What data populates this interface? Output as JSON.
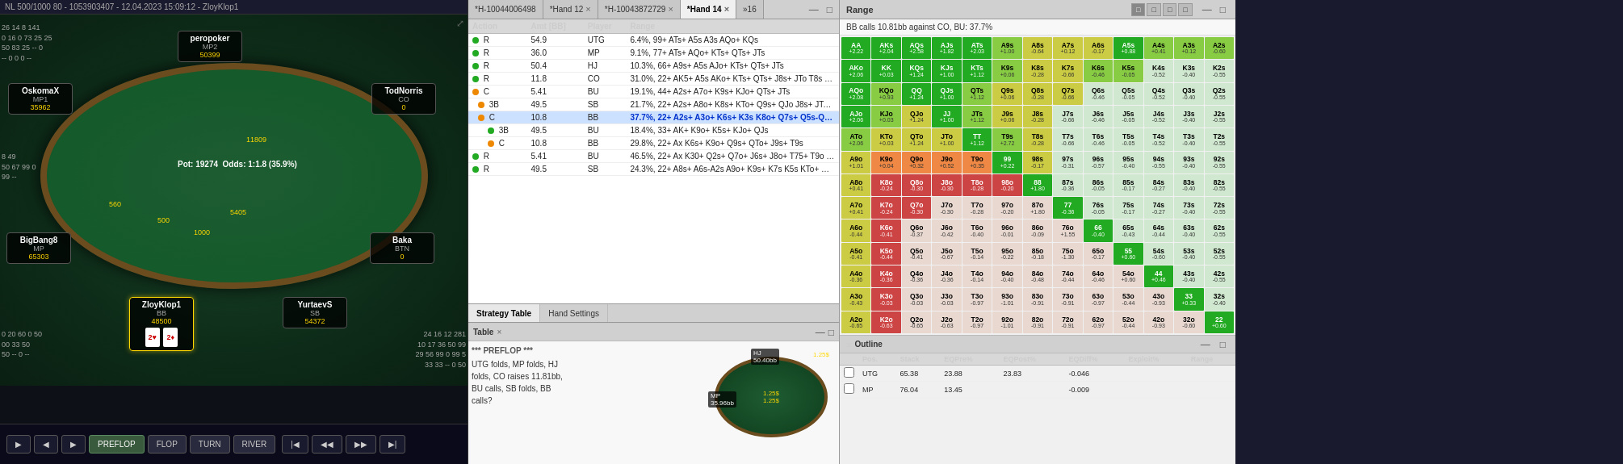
{
  "pokerPanel": {
    "header": "NL 500/1000 80 - 1053903407 - 12.04.2023 15:09:12 - ZloyKlop1",
    "pot": "19274",
    "odds": "1:1.8 (35.9%)",
    "players": [
      {
        "name": "peropoker",
        "position": "MP2",
        "chips": "50399",
        "cards": "",
        "seat": "top-center"
      },
      {
        "name": "OskomaX",
        "position": "MP1",
        "chips": "35962",
        "cards": "",
        "seat": "left-upper"
      },
      {
        "name": "TodNorris",
        "position": "CO",
        "chips": "0",
        "cards": "",
        "seat": "right-upper"
      },
      {
        "name": "Baka",
        "position": "BTN",
        "chips": "0",
        "cards": "",
        "seat": "right-lower"
      },
      {
        "name": "ZloyKlop1",
        "position": "BB",
        "chips": "48500",
        "cards": "2♥ 2♦",
        "seat": "bottom-left"
      },
      {
        "name": "YurtaevS",
        "position": "SB",
        "chips": "54372",
        "cards": "",
        "seat": "bottom-right"
      },
      {
        "name": "BigBang8",
        "position": "MP",
        "chips": "65303",
        "cards": "",
        "seat": "left-lower"
      }
    ],
    "stats": {
      "hand1": "26 14 8 141",
      "hand2": "0 16 0 73 25 25",
      "hand3": "50 83 25 -- 0",
      "hand4": "-- 0 0 0 --",
      "hand5": "8 49",
      "hand6": "50 67 99 0",
      "hand7": "99 --",
      "hand8": "0 20 60 0 50",
      "hand9": "00 33 50",
      "hand10": "50 -- 0 --",
      "hand11": "24 16 12 281",
      "hand12": "10 17 36 50 99",
      "hand13": "29 56 99 0 99 5",
      "hand14": "33 33 -- 0 50"
    },
    "controls": [
      "PREFLOP",
      "FLOP",
      "TURN",
      "RIVER"
    ],
    "chipAmounts": [
      "560",
      "5405",
      "1000",
      "500",
      "11809"
    ]
  },
  "handPanel": {
    "tabs": [
      {
        "id": "tab1",
        "label": "*H-10044006498",
        "closable": false,
        "active": false
      },
      {
        "id": "tab2",
        "label": "*Hand 12",
        "closable": true,
        "active": false
      },
      {
        "id": "tab3",
        "label": "*H-10043872729",
        "closable": true,
        "active": false
      },
      {
        "id": "tab4",
        "label": "*Hand 14",
        "closable": true,
        "active": true
      },
      {
        "id": "tab5",
        "label": "»16",
        "closable": false,
        "active": false
      }
    ],
    "columns": [
      "Action",
      "Amt [BB]",
      "Player",
      "Range"
    ],
    "rows": [
      {
        "type": "action",
        "indicator": "green",
        "action": "R",
        "amount": "54.9",
        "player": "UTG",
        "range": "6.4%, 99+ ATs+ A5s A3s AQo+ KQs",
        "expanded": false,
        "indent": 0
      },
      {
        "type": "action",
        "indicator": "green",
        "action": "R",
        "amount": "36.0",
        "player": "MP",
        "range": "9.1%, 77+ ATs+ AQo+ KTs+ QTs+ JTs",
        "expanded": false,
        "indent": 0
      },
      {
        "type": "action",
        "indicator": "green",
        "action": "R",
        "amount": "50.4",
        "player": "HJ",
        "range": "10.3%, 66+ A9s+ A5s AJo+ KTs+ QTs+ JTs",
        "expanded": false,
        "indent": 0
      },
      {
        "type": "action",
        "indicator": "green",
        "action": "R",
        "amount": "11.8",
        "player": "CO",
        "range": "31.0%, 22+ AK5+ A5s AKo+ KTs+ QTs+ J8s+ JTo T8s 98s",
        "expanded": false,
        "indent": 0
      },
      {
        "type": "action",
        "indicator": "orange",
        "action": "C",
        "amount": "5.41",
        "player": "BU",
        "range": "19.1%, 44+ A2s+ A7o+ K9s+ KJo+ QTs+ JTs",
        "expanded": false,
        "indent": 0
      },
      {
        "type": "action",
        "indicator": "orange",
        "action": "3B",
        "amount": "49.5",
        "player": "SB",
        "range": "21.7%, 22+ A2s+ A8o+ K8s+ KTo+ Q9s+ QJo J8s+ JTo T9s 76s",
        "expanded": false,
        "indent": 1
      },
      {
        "type": "action",
        "indicator": "orange",
        "action": "C",
        "amount": "10.8",
        "player": "BB",
        "range": "37.7%, 22+ A2s+ A3o+ K6s+ K3s K8o+ Q7s+ Q5s-Q4s Q9o+ J7...",
        "expanded": true,
        "highlighted": true,
        "indent": 1
      },
      {
        "type": "action",
        "indicator": "green",
        "action": "3B",
        "amount": "49.5",
        "player": "BU",
        "range": "18.4%, 33+ AK+ K9o+ K5s+ KJo+ QJs",
        "expanded": false,
        "indent": 2
      },
      {
        "type": "action",
        "indicator": "orange",
        "action": "C",
        "amount": "10.8",
        "player": "BB",
        "range": "29.8%, 22+ Ax K6s+ K9o+ Q9s+ QTo+ J9s+ T9s",
        "expanded": false,
        "indent": 2
      },
      {
        "type": "action",
        "indicator": "green",
        "action": "R",
        "amount": "5.41",
        "player": "BU",
        "range": "46.5%, 22+ Ax K30+ Q2s+ Q7o+ J6s+ J8o+ T75+ T9o 97s+",
        "expanded": false,
        "indent": 0
      },
      {
        "type": "action",
        "indicator": "green",
        "action": "R",
        "amount": "49.5",
        "player": "SB",
        "range": "24.3%, 22+ A8s+ A6s-A2s A9o+ K9s+ K7s K5s KTo+ Q8s+ QTo+...",
        "expanded": false,
        "indent": 0
      }
    ],
    "bottomTabs": [
      {
        "label": "Strategy Table",
        "active": true
      },
      {
        "label": "Hand Settings",
        "active": false
      }
    ]
  },
  "tablePanel": {
    "title": "Table",
    "closeBtn": "×",
    "text": "*** PREFLOP ***\nUTG folds, MP folds, HJ folds, CO raises 11.81bb, BU calls, SB folds, BB calls?",
    "miniPlayers": [
      {
        "label": "MP",
        "chips": "35.96bb",
        "pos": "left"
      },
      {
        "label": "HJ",
        "chips": "50.40bb",
        "pos": "top"
      }
    ],
    "potLabels": [
      "1.25$",
      "1.25$",
      "1.25$"
    ]
  },
  "rangePanel": {
    "title": "Range",
    "description": "BB calls 10.81bb against CO, BU: 37.7%",
    "viewButtons": [
      "□",
      "□",
      "□",
      "□"
    ],
    "hands": [
      [
        "AA",
        "AKs",
        "AQs",
        "AJs",
        "ATs",
        "A9s",
        "A8s",
        "A7s",
        "A6s",
        "A5s",
        "A4s",
        "A3s",
        "A2s"
      ],
      [
        "AKo",
        "KK",
        "KQs",
        "KJs",
        "KTs",
        "K9s",
        "K8s",
        "K7s",
        "K6s",
        "K5s",
        "K4s",
        "K3s",
        "K2s"
      ],
      [
        "AQo",
        "KQo",
        "QQ",
        "QJs",
        "QTs",
        "Q9s",
        "Q8s",
        "Q7s",
        "Q6s",
        "Q5s",
        "Q4s",
        "Q3s",
        "Q2s"
      ],
      [
        "AJo",
        "KJo",
        "QJo",
        "JJ",
        "JTs",
        "J9s",
        "J8s",
        "J7s",
        "J6s",
        "J5s",
        "J4s",
        "J3s",
        "J2s"
      ],
      [
        "ATo",
        "KTo",
        "QTo",
        "JTo",
        "TT",
        "T9s",
        "T8s",
        "T7s",
        "T6s",
        "T5s",
        "T4s",
        "T3s",
        "T2s"
      ],
      [
        "A9o",
        "K9o",
        "Q9o",
        "J9o",
        "T9o",
        "99",
        "98s",
        "97s",
        "96s",
        "95s",
        "94s",
        "93s",
        "92s"
      ],
      [
        "A8o",
        "K8o",
        "Q8o",
        "J8o",
        "T8o",
        "98o",
        "88",
        "87s",
        "86s",
        "85s",
        "84s",
        "83s",
        "82s"
      ],
      [
        "A7o",
        "K7o",
        "Q7o",
        "J7o",
        "T7o",
        "97o",
        "87o",
        "77",
        "76s",
        "75s",
        "74s",
        "73s",
        "72s"
      ],
      [
        "A6o",
        "K6o",
        "Q6o",
        "J6o",
        "T6o",
        "96o",
        "86o",
        "76o",
        "66",
        "65s",
        "64s",
        "63s",
        "62s"
      ],
      [
        "A5o",
        "K5o",
        "Q5o",
        "J5o",
        "T5o",
        "95o",
        "85o",
        "75o",
        "65o",
        "55",
        "54s",
        "53s",
        "52s"
      ],
      [
        "A4o",
        "K4o",
        "Q4o",
        "J4o",
        "T4o",
        "94o",
        "84o",
        "74o",
        "64o",
        "54o",
        "44",
        "43s",
        "42s"
      ],
      [
        "A3o",
        "K3o",
        "Q3o",
        "J3o",
        "T3o",
        "93o",
        "83o",
        "73o",
        "63o",
        "53o",
        "43o",
        "33",
        "32s"
      ],
      [
        "A2o",
        "K2o",
        "Q2o",
        "J2o",
        "T2o",
        "92o",
        "82o",
        "72o",
        "62o",
        "52o",
        "42o",
        "32o",
        "22"
      ]
    ],
    "handValues": [
      [
        "+2.22",
        "+2.04",
        "+2.58",
        "+1.82",
        "+2.03",
        "+1.00",
        "-0.64",
        "+0.12",
        "-0.17",
        "+0.88",
        "+0.41",
        "+0.12",
        "-0.60"
      ],
      [
        "+2.06",
        "+0.03",
        "+1.24",
        "+1.00",
        "+1.12",
        "+0.06",
        "-0.28",
        "-0.66",
        "-0.46",
        "-0.05",
        "-0.52",
        "",
        ""
      ],
      [
        "+2.08",
        "+0.93",
        "+1.24",
        "+1.00",
        "+1.12",
        "+0.06",
        "-0.28",
        "-0.66",
        "-0.46",
        "-0.05",
        "-0.52",
        "",
        ""
      ],
      [
        "+2.06",
        "+0.03",
        "+1.24",
        "+1.00",
        "+1.12",
        "+0.06",
        "-0.28",
        "-0.66",
        "-0.46",
        "-0.05",
        "-0.52",
        "",
        ""
      ],
      [
        "+2.06",
        "+0.03",
        "+1.24",
        "+1.00",
        "+1.12",
        "+2.72",
        "-0.28",
        "-0.66",
        "-0.46",
        "-0.05",
        "-0.52",
        "",
        ""
      ],
      [
        "+1.01",
        "+0.04",
        "+0.32",
        "+0.52",
        "+0.35",
        "+0.22",
        "-0.17",
        "-0.31",
        "-0.57",
        "",
        "",
        "",
        ""
      ],
      [
        "+0.41",
        "-0.24",
        "-0.30",
        "-0.30",
        "-0.28",
        "-0.20",
        "+1.80",
        "-0.36",
        "-0.05",
        "-0.17",
        "-0.27",
        "",
        ""
      ],
      [
        "+0.41",
        "-0.24",
        "-0.30",
        "-0.30",
        "-0.28",
        "-0.20",
        "+1.80",
        "-0.36",
        "-0.05",
        "-0.17",
        "-0.27",
        "",
        ""
      ],
      [
        "-0.44",
        "-0.41",
        "-0.37",
        "-0.42",
        "-0.40",
        "-0.01",
        "-0.09",
        "+1.55",
        "-0.40",
        "-0.43",
        "-0.44",
        "",
        ""
      ],
      [
        "-0.41",
        "-0.44",
        "-0.41",
        "-0.67",
        "-0.14",
        "-0.22",
        "-0.18",
        "-1.30",
        "-0.17",
        "+0.60",
        "-0.60",
        "",
        ""
      ],
      [
        "-0.36",
        "-0.36",
        "-0.36",
        "-0.36",
        "-0.14",
        "-0.40",
        "-0.48",
        "-0.44",
        "-0.46",
        "+0.60",
        "44",
        "",
        ""
      ],
      [
        "-0.43",
        "-0.03",
        "-0.03",
        "-0.03",
        "-0.97",
        "-1.01",
        "-0.91",
        "-0.91",
        "-0.97",
        "-0.44",
        "-0.93",
        "33",
        ""
      ],
      [
        "-0.65",
        "-0.63",
        "-0.65",
        "-0.63",
        "-0.97",
        "-1.01",
        "-0.91",
        "-0.91",
        "-0.97",
        "-0.44",
        "-0.93",
        "-0.60",
        "+0.60"
      ]
    ],
    "cellColors": {
      "AA": "high-freq",
      "AKs": "high-freq",
      "AQs": "high-freq",
      "AJs": "high-freq",
      "ATs": "high-freq",
      "A9s": "med-freq",
      "A8s": "low-freq",
      "A7s": "low-freq",
      "A6s": "low-freq",
      "A5s": "high-freq",
      "A4s": "med-freq",
      "A3s": "med-freq",
      "A2s": "med-freq",
      "AKo": "high-freq",
      "KK": "high-freq",
      "KQs": "high-freq",
      "KJs": "high-freq",
      "KTs": "high-freq",
      "K9s": "med-freq",
      "K8s": "low-freq",
      "K7s": "low-freq",
      "K6s": "med-freq",
      "K5s": "med-freq",
      "AQo": "high-freq",
      "KQo": "med-freq",
      "QQ": "high-freq",
      "QJs": "high-freq",
      "QTs": "med-freq",
      "Q9s": "low-freq",
      "Q8s": "low-freq",
      "Q7s": "low-freq",
      "AJo": "high-freq",
      "KJo": "med-freq",
      "QJo": "low-freq",
      "JJ": "high-freq",
      "JTs": "med-freq",
      "J9s": "low-freq",
      "J8s": "low-freq",
      "ATo": "med-freq",
      "KTo": "low-freq",
      "QTo": "low-freq",
      "JTo": "low-freq",
      "TT": "high-freq",
      "T9s": "med-freq",
      "T8s": "low-freq",
      "A9o": "low-freq",
      "K9o": "very-low",
      "Q9o": "very-low",
      "J9o": "very-low",
      "T9o": "very-low",
      "99": "high-freq",
      "98s": "low-freq",
      "A8o": "low-freq",
      "K8o": "fold",
      "Q8o": "fold",
      "J8o": "fold",
      "T8o": "fold",
      "98o": "fold",
      "88": "high-freq",
      "A7o": "low-freq",
      "K7o": "fold",
      "Q7o": "fold",
      "77": "high-freq",
      "A6o": "low-freq",
      "K6o": "fold",
      "66": "high-freq",
      "A5o": "low-freq",
      "K5o": "fold",
      "55": "high-freq",
      "A4o": "low-freq",
      "K4o": "fold",
      "44": "high-freq",
      "A3o": "low-freq",
      "K3o": "fold",
      "33": "high-freq",
      "A2o": "low-freq",
      "K2o": "fold",
      "22": "high-freq"
    }
  },
  "outlinePanel": {
    "title": "Outline",
    "columns": [
      "",
      "Pos.",
      "Stack",
      "EQPre%",
      "EQPost%",
      "EQDiff%",
      "Exploit%",
      "Range"
    ],
    "rows": [
      {
        "checked": false,
        "pos": "UTG",
        "stack": "65.38",
        "eqpre": "23.88",
        "eqpost": "23.83",
        "eqdiff": "-0.046",
        "exploit": ""
      },
      {
        "checked": false,
        "pos": "MP",
        "stack": "76.04",
        "eqpre": "13.45",
        "eqpost": "",
        "eqdiff": "-0.009",
        "exploit": ""
      }
    ]
  }
}
